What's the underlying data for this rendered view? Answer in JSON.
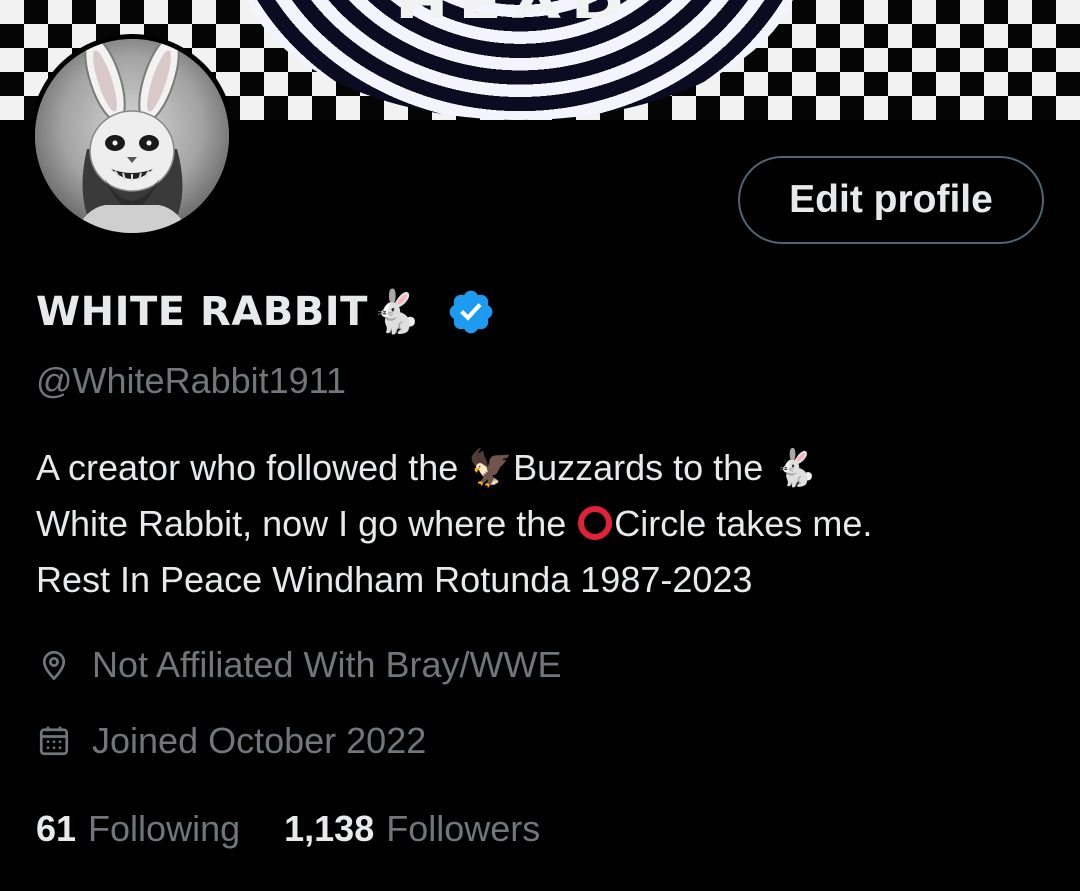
{
  "banner": {
    "partial_text": "HEAD"
  },
  "profile": {
    "display_name": "WHITE RABBIT",
    "name_emoji": "🐇",
    "verified_icon": "verified-badge-icon",
    "handle": "@WhiteRabbit1911",
    "edit_profile_label": "Edit profile"
  },
  "bio": {
    "line1_a": "A creator who followed the ",
    "line1_emoji_a": "🦅",
    "line1_b": "Buzzards to the ",
    "line1_emoji_b": "🐇",
    "line2_a": "White Rabbit, now I go where the ",
    "line2_b": "Circle takes me.",
    "line3": "Rest In Peace  Windham Rotunda 1987-2023"
  },
  "meta": {
    "location": "Not Affiliated With Bray/WWE",
    "location_icon": "location-pin-icon",
    "joined": "Joined October 2022",
    "joined_icon": "calendar-icon"
  },
  "stats": {
    "following_count": "61",
    "following_label": "Following",
    "followers_count": "1,138",
    "followers_label": "Followers"
  },
  "colors": {
    "background": "#000000",
    "primary_text": "#e7e9ea",
    "secondary_text": "#71767b",
    "verified_blue": "#1d9bf0",
    "button_border": "#536471",
    "circle_red": "#e0213a"
  }
}
